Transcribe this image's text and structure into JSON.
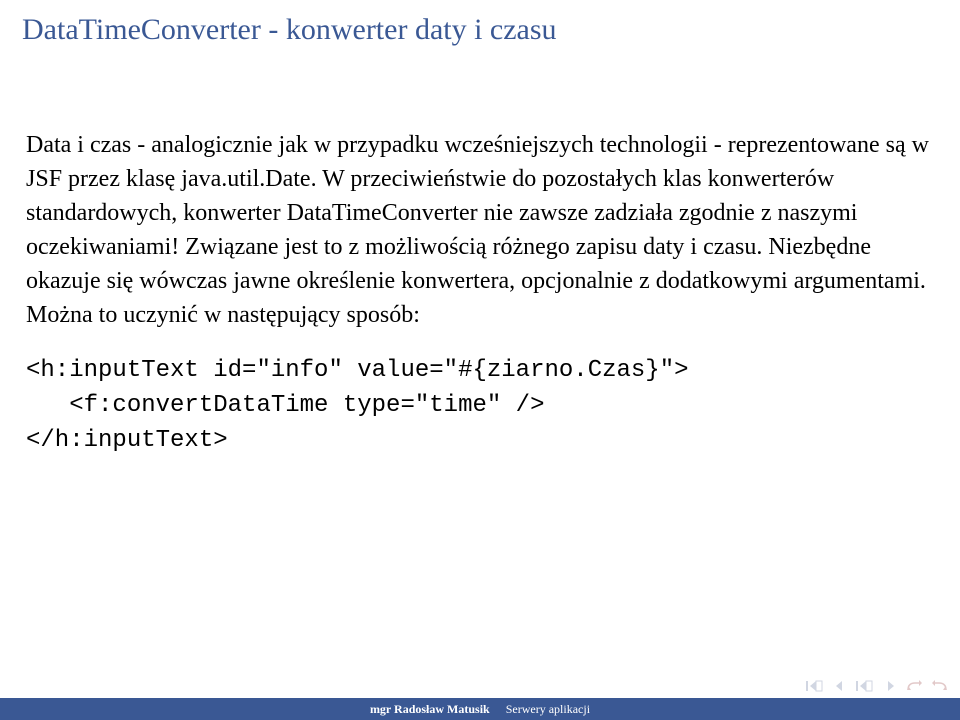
{
  "title": "DataTimeConverter - konwerter daty i czasu",
  "body": "Data i czas - analogicznie jak w przypadku wcześniejszych technologii - reprezentowane są w JSF przez klasę java.util.Date. W przeciwieństwie do pozostałych klas konwerterów standardowych, konwerter DataTimeConverter nie zawsze zadziała zgodnie z naszymi oczekiwaniami! Związane jest to z możliwością różnego zapisu daty i czasu. Niezbędne okazuje się wówczas jawne określenie konwertera, opcjonalnie z dodatkowymi argumentami. Można to uczynić w następujący sposób:",
  "code": "<h:inputText id=\"info\" value=\"#{ziarno.Czas}\">\n   <f:convertDataTime type=\"time\" />\n</h:inputText>",
  "footer": {
    "author": "mgr Radosław Matusik",
    "subject": "Serwery aplikacji"
  }
}
